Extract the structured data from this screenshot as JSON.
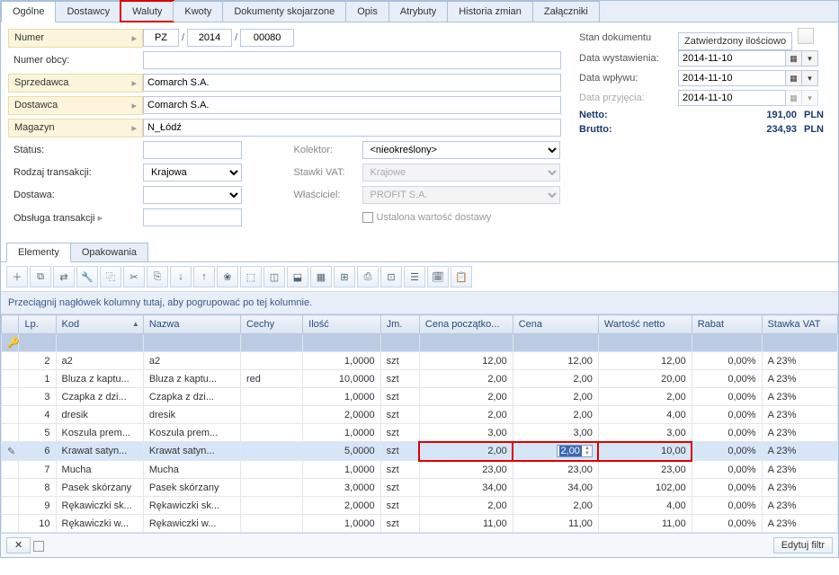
{
  "tabs": [
    "Ogólne",
    "Dostawcy",
    "Waluty",
    "Kwoty",
    "Dokumenty skojarzone",
    "Opis",
    "Atrybuty",
    "Historia zmian",
    "Załączniki"
  ],
  "active_tab": 0,
  "highlighted_tab": 2,
  "form": {
    "numer_label": "Numer",
    "numer_prefix": "PZ",
    "numer_year": "2014",
    "numer_seq": "00080",
    "numer_obcy_label": "Numer obcy:",
    "numer_obcy": "",
    "sprzedawca_label": "Sprzedawca",
    "sprzedawca": "Comarch S.A.",
    "dostawca_label": "Dostawca",
    "dostawca": "Comarch S.A.",
    "magazyn_label": "Magazyn",
    "magazyn": "N_Łódź",
    "status_label": "Status:",
    "status": "",
    "rodzaj_label": "Rodzaj transakcji:",
    "rodzaj": "Krajowa",
    "dostawa_label2": "Dostawa:",
    "dostawa_val": "",
    "obsluga_label": "Obsługa transakcji",
    "obsluga": "",
    "kolektor_label": "Kolektor:",
    "kolektor": "<nieokreślony>",
    "stawki_label": "Stawki VAT:",
    "stawki": "Krajowe",
    "wlasciciel_label": "Właściciel:",
    "wlasciciel": "PROFIT S.A.",
    "ustalona_label": "Ustalona wartość dostawy"
  },
  "summary": {
    "stan_label": "Stan dokumentu",
    "stan": "Zatwierdzony ilościowo",
    "data_wyst_label": "Data wystawienia:",
    "data_wyst": "2014-11-10",
    "data_wplywu_label": "Data wpływu:",
    "data_wplywu": "2014-11-10",
    "data_przyj_label": "Data przyjęcia:",
    "data_przyj": "2014-11-10",
    "netto_label": "Netto:",
    "netto": "191,00",
    "brutto_label": "Brutto:",
    "brutto": "234,93",
    "currency": "PLN"
  },
  "sub_tabs": [
    "Elementy",
    "Opakowania"
  ],
  "active_sub_tab": 0,
  "toolbar_icons": [
    "＋",
    "⧉",
    "⇄",
    "🔧",
    "⿻",
    "✂",
    "⎘",
    "↓",
    "↑",
    "❀",
    "⬚",
    "◫",
    "⬓",
    "▦",
    "⊞",
    "⎙",
    "⊡",
    "☰",
    "🗓",
    "📋"
  ],
  "group_hint": "Przeciągnij nagłówek kolumny tutaj, aby pogrupować po tej kolumnie.",
  "columns": [
    "",
    "Lp.",
    "Kod",
    "Nazwa",
    "Cechy",
    "Ilość",
    "Jm.",
    "Cena początko...",
    "Cena",
    "Wartość netto",
    "Rabat",
    "Stawka VAT"
  ],
  "rows": [
    {
      "lp": "2",
      "kod": "a2",
      "nazwa": "a2",
      "cechy": "",
      "ilosc": "1,0000",
      "jm": "szt",
      "cenap": "12,00",
      "cena": "12,00",
      "wartosc": "12,00",
      "rabat": "0,00%",
      "vat": "A 23%"
    },
    {
      "lp": "1",
      "kod": "Bluza z kaptu...",
      "nazwa": "Bluza z kaptu...",
      "cechy": "red",
      "ilosc": "10,0000",
      "jm": "szt",
      "cenap": "2,00",
      "cena": "2,00",
      "wartosc": "20,00",
      "rabat": "0,00%",
      "vat": "A 23%"
    },
    {
      "lp": "3",
      "kod": "Czapka z dzi...",
      "nazwa": "Czapka z dzi...",
      "cechy": "",
      "ilosc": "1,0000",
      "jm": "szt",
      "cenap": "2,00",
      "cena": "2,00",
      "wartosc": "2,00",
      "rabat": "0,00%",
      "vat": "A 23%"
    },
    {
      "lp": "4",
      "kod": "dresik",
      "nazwa": "dresik",
      "cechy": "",
      "ilosc": "2,0000",
      "jm": "szt",
      "cenap": "2,00",
      "cena": "2,00",
      "wartosc": "4,00",
      "rabat": "0,00%",
      "vat": "A 23%"
    },
    {
      "lp": "5",
      "kod": "Koszula prem...",
      "nazwa": "Koszula prem...",
      "cechy": "",
      "ilosc": "1,0000",
      "jm": "szt",
      "cenap": "3,00",
      "cena": "3,00",
      "wartosc": "3,00",
      "rabat": "0,00%",
      "vat": "A 23%"
    },
    {
      "lp": "6",
      "kod": "Krawat satyn...",
      "nazwa": "Krawat satyn...",
      "cechy": "",
      "ilosc": "5,0000",
      "jm": "szt",
      "cenap": "2,00",
      "cena": "2,00",
      "wartosc": "10,00",
      "rabat": "0,00%",
      "vat": "A 23%",
      "selected": true,
      "editing": true
    },
    {
      "lp": "7",
      "kod": "Mucha",
      "nazwa": "Mucha",
      "cechy": "",
      "ilosc": "1,0000",
      "jm": "szt",
      "cenap": "23,00",
      "cena": "23,00",
      "wartosc": "23,00",
      "rabat": "0,00%",
      "vat": "A 23%"
    },
    {
      "lp": "8",
      "kod": "Pasek skórzany",
      "nazwa": "Pasek skórzany",
      "cechy": "",
      "ilosc": "3,0000",
      "jm": "szt",
      "cenap": "34,00",
      "cena": "34,00",
      "wartosc": "102,00",
      "rabat": "0,00%",
      "vat": "A 23%"
    },
    {
      "lp": "9",
      "kod": "Rękawiczki sk...",
      "nazwa": "Rękawiczki sk...",
      "cechy": "",
      "ilosc": "2,0000",
      "jm": "szt",
      "cenap": "2,00",
      "cena": "2,00",
      "wartosc": "4,00",
      "rabat": "0,00%",
      "vat": "A 23%"
    },
    {
      "lp": "10",
      "kod": "Rękawiczki w...",
      "nazwa": "Rękawiczki w...",
      "cechy": "",
      "ilosc": "1,0000",
      "jm": "szt",
      "cenap": "11,00",
      "cena": "11,00",
      "wartosc": "11,00",
      "rabat": "0,00%",
      "vat": "A 23%"
    }
  ],
  "footer": {
    "close": "✕",
    "edit_filter": "Edytuj filtr"
  }
}
